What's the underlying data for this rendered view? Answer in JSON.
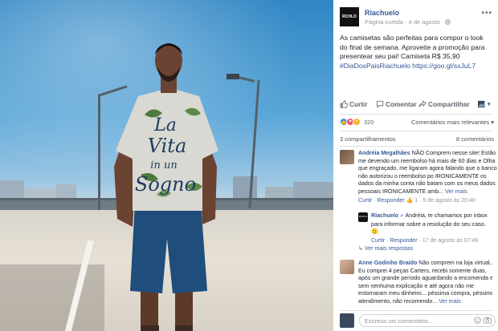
{
  "photo": {
    "shirt_text": [
      "La",
      "Vita",
      "in un",
      "Sogno"
    ]
  },
  "post": {
    "page_name": "Riachuelo",
    "logo_text": "RCHLO",
    "meta": "Página curtida · 4 de agosto · ",
    "text": "As camisetas são perfeitas para compor o look do final de semana. Aproveite a promoção para presentear seu pai! Camiseta R$ 35,90",
    "hashtag": "#DiaDosPaisRiachuelo",
    "link": "https://goo.gl/sxJuL7"
  },
  "actions": {
    "like": "Curtir",
    "comment": "Comentar",
    "share": "Compartilhar"
  },
  "reactions": {
    "count": "320",
    "most_relevant": "Comentários mais relevantes ▾"
  },
  "stats": {
    "shares": "3 compartilhamentos",
    "comments": "8 comentários"
  },
  "comments": [
    {
      "name": "Andréia Megalhães",
      "text": "NÃO Comprem nesse site! Estão me devendo um reembolso há mais de 60 dias e Olha que engraçado, me ligaram agora falando que o banco não autorizou o reembolso po IRONICAMENTE os dados da minha conta não batam com os meus dados pessoais IRONICAMENTE amb...",
      "more": "Ver mais",
      "like": "Curtir",
      "reply": "Responder",
      "reply_count": "1",
      "time": "5 de agosto às 20:40"
    },
    {
      "name": "Riachuelo",
      "text": "Andréia, te chamamos por inbox para informar sobre a resolução do seu caso. 🙂",
      "like": "Curtir",
      "reply": "Responder",
      "time": "17 de agosto às 07:49"
    },
    {
      "name": "Anne Godinho Braido",
      "text": "Não comprem na loja virtual... Eu comprei 4 peças Carters, recebi somente duas, após um grande período aguardando a encomenda e sem nenhuma explicação e até agora não me estornaram meu dinheiro... péssima compra, péssimo atendimento, não recomendo...",
      "more": "Ver mais"
    }
  ],
  "more_replies": "Ver mais respostas",
  "write_comment": {
    "placeholder": "Escreva um comentário..."
  },
  "colors": {
    "link": "#365899",
    "muted": "#90949c",
    "divider": "#dddfe2"
  }
}
